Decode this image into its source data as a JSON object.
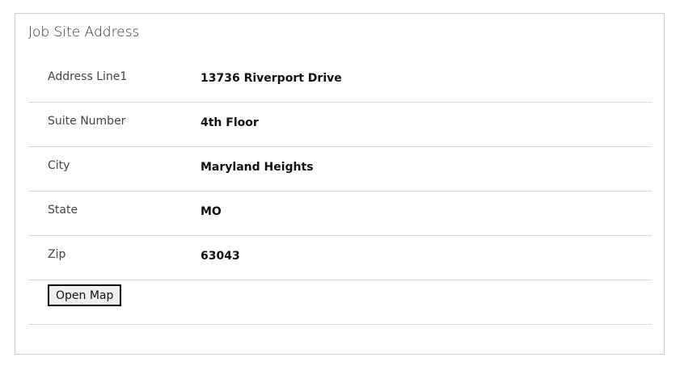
{
  "section": {
    "title": "Job Site Address"
  },
  "fields": [
    {
      "label": "Address Line1",
      "value": "13736 Riverport Drive"
    },
    {
      "label": "Suite Number",
      "value": "4th Floor"
    },
    {
      "label": "City",
      "value": "Maryland Heights"
    },
    {
      "label": "State",
      "value": "MO"
    },
    {
      "label": "Zip",
      "value": "63043"
    }
  ],
  "actions": {
    "open_map": "Open Map"
  }
}
